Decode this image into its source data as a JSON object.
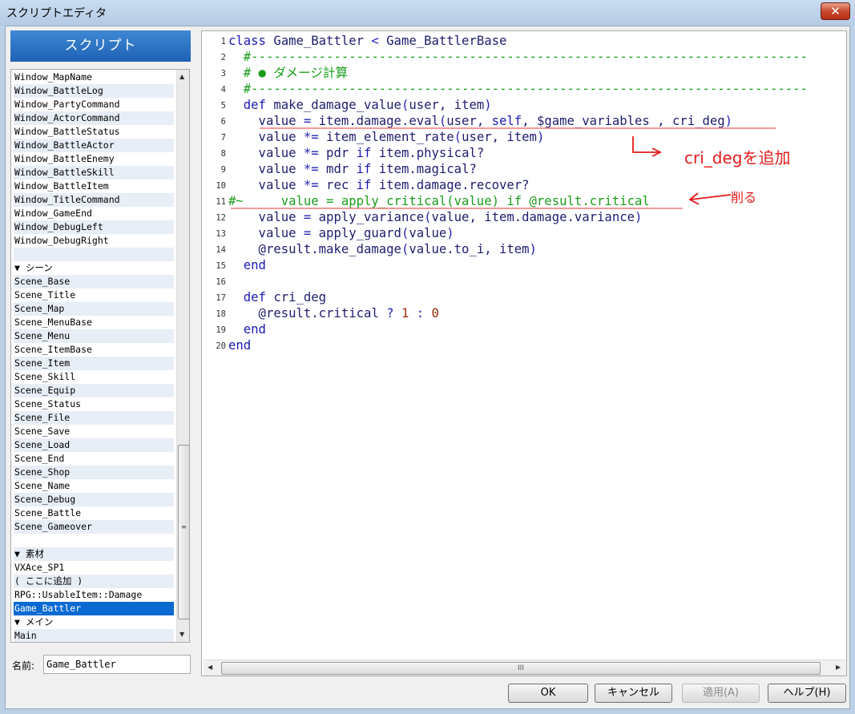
{
  "window": {
    "title": "スクリプトエディタ",
    "close_label": "✕"
  },
  "sidebar": {
    "header": "スクリプト",
    "items": [
      "Window_MapName",
      "Window_BattleLog",
      "Window_PartyCommand",
      "Window_ActorCommand",
      "Window_BattleStatus",
      "Window_BattleActor",
      "Window_BattleEnemy",
      "Window_BattleSkill",
      "Window_BattleItem",
      "Window_TitleCommand",
      "Window_GameEnd",
      "Window_DebugLeft",
      "Window_DebugRight",
      "",
      "▼ シーン",
      "Scene_Base",
      "Scene_Title",
      "Scene_Map",
      "Scene_MenuBase",
      "Scene_Menu",
      "Scene_ItemBase",
      "Scene_Item",
      "Scene_Skill",
      "Scene_Equip",
      "Scene_Status",
      "Scene_File",
      "Scene_Save",
      "Scene_Load",
      "Scene_End",
      "Scene_Shop",
      "Scene_Name",
      "Scene_Debug",
      "Scene_Battle",
      "Scene_Gameover",
      "",
      "▼ 素材",
      "VXAce_SP1",
      "( ここに追加 )",
      "RPG::UsableItem::Damage",
      "Game_Battler",
      "▼ メイン",
      "Main"
    ],
    "selected": "Game_Battler",
    "name_label": "名前:",
    "name_value": "Game_Battler"
  },
  "editor": {
    "line_numbers": [
      "1",
      "2",
      "3",
      "4",
      "5",
      "6",
      "7",
      "8",
      "9",
      "10",
      "11",
      "12",
      "13",
      "14",
      "15",
      "16",
      "17",
      "18",
      "19",
      "20"
    ],
    "scroll_grip": "III"
  },
  "annotations": {
    "add_note": "cri_degを追加",
    "delete_note": "削る"
  },
  "buttons": {
    "ok": "OK",
    "cancel": "キャンセル",
    "apply": "適用(A)",
    "help": "ヘルプ(H)"
  }
}
